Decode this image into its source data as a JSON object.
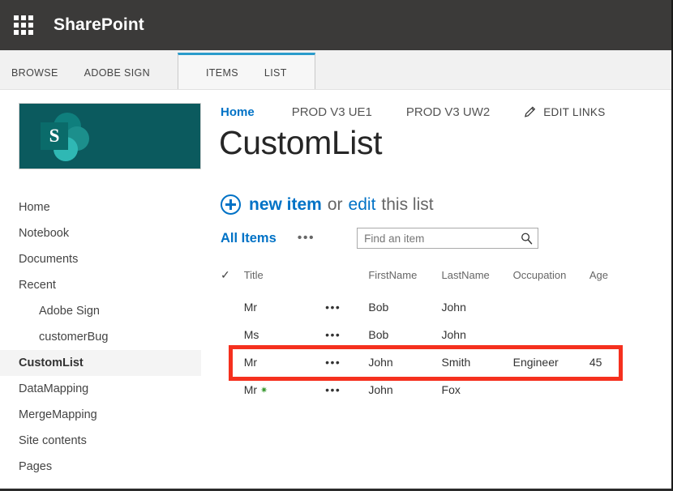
{
  "suite": {
    "waffle_icon": "waffle-grid-icon",
    "title": "SharePoint"
  },
  "ribbon": {
    "tabs": [
      {
        "label": "BROWSE",
        "active": false
      },
      {
        "label": "ADOBE SIGN",
        "active": false
      },
      {
        "label": "ITEMS",
        "active": true
      },
      {
        "label": "LIST",
        "active": true
      }
    ]
  },
  "site_logo": {
    "letter": "S",
    "background": "#0b5a5e"
  },
  "top_links": [
    {
      "label": "Home",
      "active": true
    },
    {
      "label": "PROD V3 UE1",
      "active": false
    },
    {
      "label": "PROD V3 UW2",
      "active": false
    }
  ],
  "edit_links": {
    "label": "EDIT LINKS",
    "icon": "pencil-icon"
  },
  "page": {
    "title": "CustomList"
  },
  "commands": {
    "plus_icon": "plus-circle-icon",
    "new_item": "new item",
    "or": "or",
    "edit": "edit",
    "this_list": "this list"
  },
  "view": {
    "name": "All Items",
    "ellipsis": "•••"
  },
  "search": {
    "placeholder": "Find an item",
    "value": "",
    "icon": "search-icon"
  },
  "sidebar": {
    "items": [
      {
        "label": "Home",
        "indent": false,
        "selected": false
      },
      {
        "label": "Notebook",
        "indent": false,
        "selected": false
      },
      {
        "label": "Documents",
        "indent": false,
        "selected": false
      },
      {
        "label": "Recent",
        "indent": false,
        "selected": false
      },
      {
        "label": "Adobe Sign",
        "indent": true,
        "selected": false
      },
      {
        "label": "customerBug",
        "indent": true,
        "selected": false
      },
      {
        "label": "CustomList",
        "indent": false,
        "selected": true
      },
      {
        "label": "DataMapping",
        "indent": false,
        "selected": false
      },
      {
        "label": "MergeMapping",
        "indent": false,
        "selected": false
      },
      {
        "label": "Site contents",
        "indent": false,
        "selected": false
      },
      {
        "label": "Pages",
        "indent": false,
        "selected": false
      }
    ]
  },
  "list": {
    "columns": [
      {
        "key": "check",
        "label": "✓"
      },
      {
        "key": "title",
        "label": "Title"
      },
      {
        "key": "dots",
        "label": ""
      },
      {
        "key": "firstname",
        "label": "FirstName"
      },
      {
        "key": "lastname",
        "label": "LastName"
      },
      {
        "key": "occupation",
        "label": "Occupation"
      },
      {
        "key": "age",
        "label": "Age"
      }
    ],
    "rows": [
      {
        "title": "Mr",
        "dots": "•••",
        "firstname": "Bob",
        "lastname": "John",
        "occupation": "",
        "age": "",
        "new_badge": false,
        "highlighted": false
      },
      {
        "title": "Ms",
        "dots": "•••",
        "firstname": "Bob",
        "lastname": "John",
        "occupation": "",
        "age": "",
        "new_badge": false,
        "highlighted": false
      },
      {
        "title": "Mr",
        "dots": "•••",
        "firstname": "John",
        "lastname": "Smith",
        "occupation": "Engineer",
        "age": "45",
        "new_badge": false,
        "highlighted": true
      },
      {
        "title": "Mr",
        "dots": "•••",
        "firstname": "John",
        "lastname": "Fox",
        "occupation": "",
        "age": "",
        "new_badge": true,
        "highlighted": false
      }
    ]
  },
  "annotation": {
    "color": "#f5301e",
    "target_row_index": 2
  },
  "colors": {
    "suite_bar": "#3b3a39",
    "ribbon": "#f1f1f1",
    "accent_blue": "#0072c6",
    "tab_top_border": "#2b9ccc",
    "new_badge_green": "#3d9b35"
  }
}
